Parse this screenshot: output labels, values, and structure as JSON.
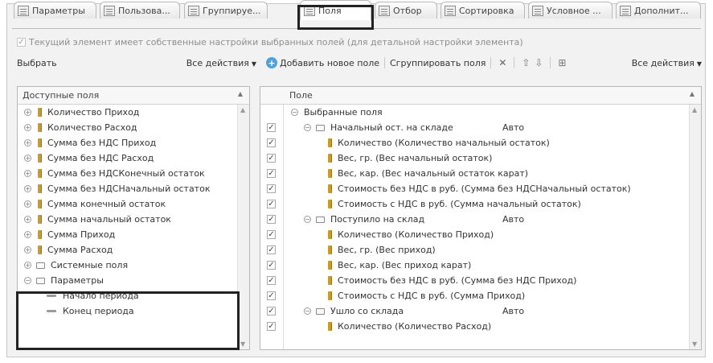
{
  "tabs": [
    {
      "label": "Параметры",
      "active": false
    },
    {
      "label": "Пользова...",
      "active": false
    },
    {
      "label": "Группируе...",
      "active": false
    },
    {
      "label": "Поля",
      "active": true
    },
    {
      "label": "Отбор",
      "active": false
    },
    {
      "label": "Сортировка",
      "active": false
    },
    {
      "label": "Условное ...",
      "active": false
    },
    {
      "label": "Дополнит...",
      "active": false
    }
  ],
  "own_settings_label": "Текущий элемент имеет собственные настройки выбранных полей (для детальной настройки элемента)",
  "left_toolbar": {
    "select": "Выбрать",
    "all_actions": "Все действия"
  },
  "right_toolbar": {
    "add_field": "Добавить новое поле",
    "group_fields": "Сгруппировать поля",
    "all_actions": "Все действия"
  },
  "left_panel": {
    "header": "Доступные поля",
    "items": [
      {
        "label": "Количество Приход",
        "kind": "field"
      },
      {
        "label": "Количество Расход",
        "kind": "field"
      },
      {
        "label": "Сумма без НДС Приход",
        "kind": "field"
      },
      {
        "label": "Сумма без НДС Расход",
        "kind": "field"
      },
      {
        "label": "Сумма без НДСКонечный остаток",
        "kind": "field"
      },
      {
        "label": "Сумма без НДСНачальный остаток",
        "kind": "field"
      },
      {
        "label": "Сумма конечный остаток",
        "kind": "field"
      },
      {
        "label": "Сумма начальный остаток",
        "kind": "field"
      },
      {
        "label": "Сумма Приход",
        "kind": "field"
      },
      {
        "label": "Сумма Расход",
        "kind": "field"
      },
      {
        "label": "Системные поля",
        "kind": "folder"
      },
      {
        "label": "Параметры",
        "kind": "folder-open"
      },
      {
        "label": "Начало периода",
        "kind": "param"
      },
      {
        "label": "Конец периода",
        "kind": "param"
      }
    ]
  },
  "right_panel": {
    "header": "Поле",
    "rows": [
      {
        "label": "Выбранные поля",
        "level": 0,
        "kind": "root",
        "checked": null,
        "extra": ""
      },
      {
        "label": "Начальный ост. на складе",
        "level": 1,
        "kind": "folder",
        "checked": true,
        "extra": "Авто"
      },
      {
        "label": "Количество (Количество начальный остаток)",
        "level": 2,
        "kind": "field",
        "checked": true,
        "extra": ""
      },
      {
        "label": "Вес, гр. (Вес начальный остаток)",
        "level": 2,
        "kind": "field",
        "checked": true,
        "extra": ""
      },
      {
        "label": "Вес, кар. (Вес начальный остаток карат)",
        "level": 2,
        "kind": "field",
        "checked": true,
        "extra": ""
      },
      {
        "label": "Стоимость без НДС в руб. (Сумма без НДСНачальный остаток)",
        "level": 2,
        "kind": "field",
        "checked": true,
        "extra": ""
      },
      {
        "label": "Стоимость с НДС в руб. (Сумма начальный остаток)",
        "level": 2,
        "kind": "field",
        "checked": true,
        "extra": ""
      },
      {
        "label": "Поступило на склад",
        "level": 1,
        "kind": "folder",
        "checked": true,
        "extra": "Авто"
      },
      {
        "label": "Количество (Количество Приход)",
        "level": 2,
        "kind": "field",
        "checked": true,
        "extra": ""
      },
      {
        "label": "Вес, гр. (Вес приход)",
        "level": 2,
        "kind": "field",
        "checked": true,
        "extra": ""
      },
      {
        "label": "Вес, кар. (Вес приход карат)",
        "level": 2,
        "kind": "field",
        "checked": true,
        "extra": ""
      },
      {
        "label": "Стоимость без НДС в руб. (Сумма без НДС Приход)",
        "level": 2,
        "kind": "field",
        "checked": true,
        "extra": ""
      },
      {
        "label": "Стоимость с НДС в руб. (Сумма Приход)",
        "level": 2,
        "kind": "field",
        "checked": true,
        "extra": ""
      },
      {
        "label": "Ушло со склада",
        "level": 1,
        "kind": "folder",
        "checked": true,
        "extra": "Авто"
      },
      {
        "label": "Количество (Количество Расход)",
        "level": 2,
        "kind": "field",
        "checked": true,
        "extra": ""
      }
    ]
  }
}
